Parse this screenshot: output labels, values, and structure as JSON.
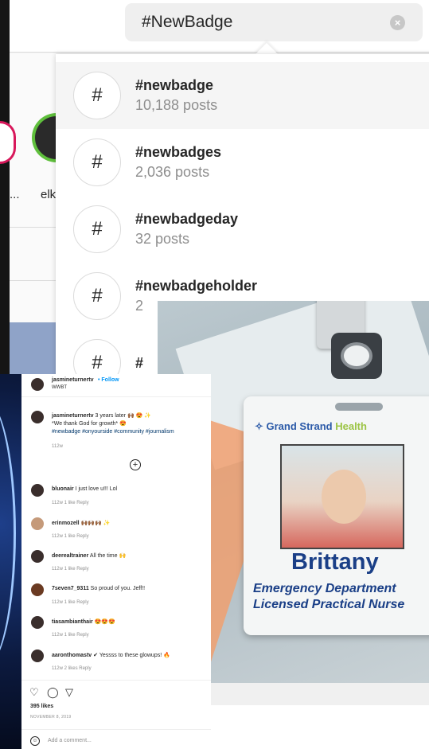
{
  "search": {
    "query": "#NewBadge",
    "clear_icon": "×"
  },
  "stories": {
    "partial_label": "elk",
    "dots": "..."
  },
  "results": [
    {
      "icon": "#",
      "tag": "#newbadge",
      "count": "10,188 posts"
    },
    {
      "icon": "#",
      "tag": "#newbadges",
      "count": "2,036 posts"
    },
    {
      "icon": "#",
      "tag": "#newbadgeday",
      "count": "32 posts"
    },
    {
      "icon": "#",
      "tag": "#newbadgeholder",
      "count": "2"
    },
    {
      "icon": "#",
      "tag": "#",
      "count": ""
    }
  ],
  "badge": {
    "org": "Grand Strand",
    "org_suffix": "Health",
    "name": "Brittany",
    "dept_line1": "Emergency Department",
    "dept_line2": "Licensed Practical Nurse"
  },
  "post": {
    "username": "jasmineturnertv",
    "follow": "• Follow",
    "subtitle": "WWBT",
    "caption_user": "jasmineturnertv",
    "caption_text": " 3 years later 🙌🏾 😍 ✨",
    "caption_line2": "*We thank God for growth* 😍",
    "caption_tags": "#newbadge #onyourside #community #journalism",
    "caption_time": "112w",
    "comments": [
      {
        "user": "bluonair",
        "text": " I just love u!!! Lol",
        "meta": "112w   1 like   Reply"
      },
      {
        "user": "erinmozell",
        "text": " 🙌🏾🙌🏾🙌🏾 ✨",
        "meta": "112w   1 like   Reply"
      },
      {
        "user": "deerealtrainer",
        "text": " All the time 🙌",
        "meta": "112w   1 like   Reply"
      },
      {
        "user": "7seven7_9311",
        "text": " So proud of you. Jeff!!",
        "meta": "112w   1 like   Reply"
      },
      {
        "user": "tiasambianthair",
        "text": " 😍😍😍",
        "meta": "112w   1 like   Reply"
      },
      {
        "user": "aaronthomastv",
        "text": " ✔ Yessss to these glowups! 🔥",
        "meta": "112w   2 likes   Reply"
      }
    ],
    "likes": "395 likes",
    "date": "NOVEMBER 8, 2019",
    "add_comment_placeholder": "Add a comment..."
  }
}
